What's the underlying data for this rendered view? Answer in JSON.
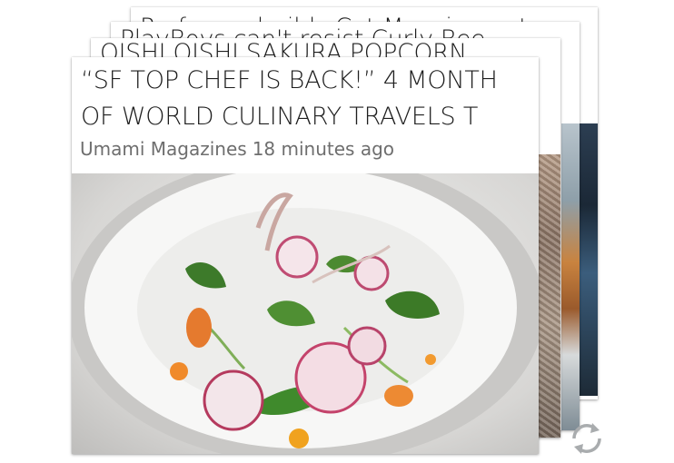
{
  "cards": [
    {
      "title_line1": "“SF TOP CHEF IS BACK!” 4 MONTH",
      "title_line2": "OF WORLD CULINARY TRAVELS T",
      "source": "Umami Magazines",
      "time": "18 minutes ago"
    },
    {
      "title": "OISHI OISHI SAKURA POPCORN"
    },
    {
      "title": "PlayBoys can't resist Curly Bee"
    },
    {
      "title": "Professor builds Cat Mansion out"
    }
  ],
  "icons": {
    "refresh": "refresh-icon"
  }
}
